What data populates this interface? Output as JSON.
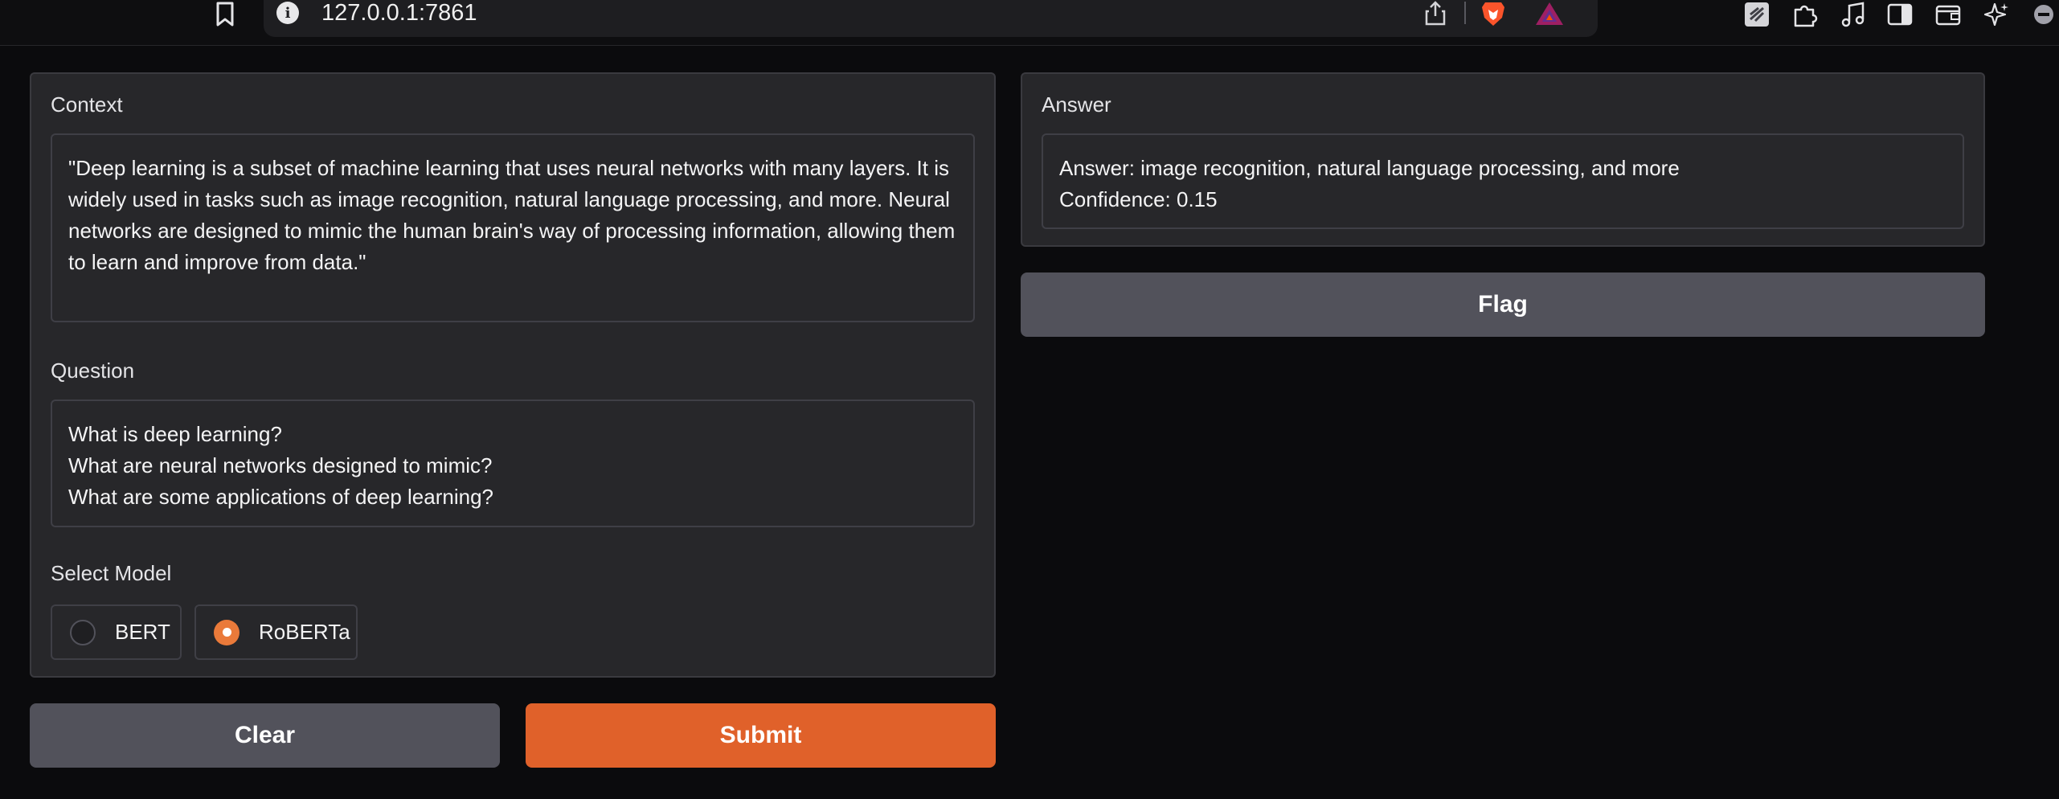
{
  "browser": {
    "url": "127.0.0.1:7861",
    "icons": [
      "bookmark-icon",
      "site-info-icon",
      "share-icon",
      "brave-lion-icon",
      "bat-rewards-icon",
      "extension-stripe-icon",
      "puzzle-extensions-icon",
      "music-note-icon",
      "sidebar-icon",
      "wallet-icon",
      "sparkle-ai-icon",
      "minimize-icon"
    ],
    "info_glyph": "i"
  },
  "context": {
    "label": "Context",
    "value": "\"Deep learning is a subset of machine learning that uses neural networks with many layers. It is widely used in tasks such as image recognition, natural language processing, and more. Neural networks are designed to mimic the human brain's way of processing information, allowing them to learn and improve from data.\""
  },
  "question": {
    "label": "Question",
    "value": "What is deep learning?\nWhat are neural networks designed to mimic?\nWhat are some applications of deep learning?"
  },
  "model": {
    "label": "Select Model",
    "options": [
      {
        "label": "BERT",
        "selected": false
      },
      {
        "label": "RoBERTa",
        "selected": true
      }
    ]
  },
  "actions": {
    "clear_label": "Clear",
    "submit_label": "Submit"
  },
  "answer": {
    "label": "Answer",
    "value": "Answer: image recognition, natural language processing, and more\nConfidence: 0.15"
  },
  "flag_label": "Flag",
  "colors": {
    "accent": "#e0612a",
    "radio_checked": "#ea7a3a",
    "panel": "#27272a",
    "background": "#0b0b0d",
    "secondary_button": "#52525b"
  }
}
